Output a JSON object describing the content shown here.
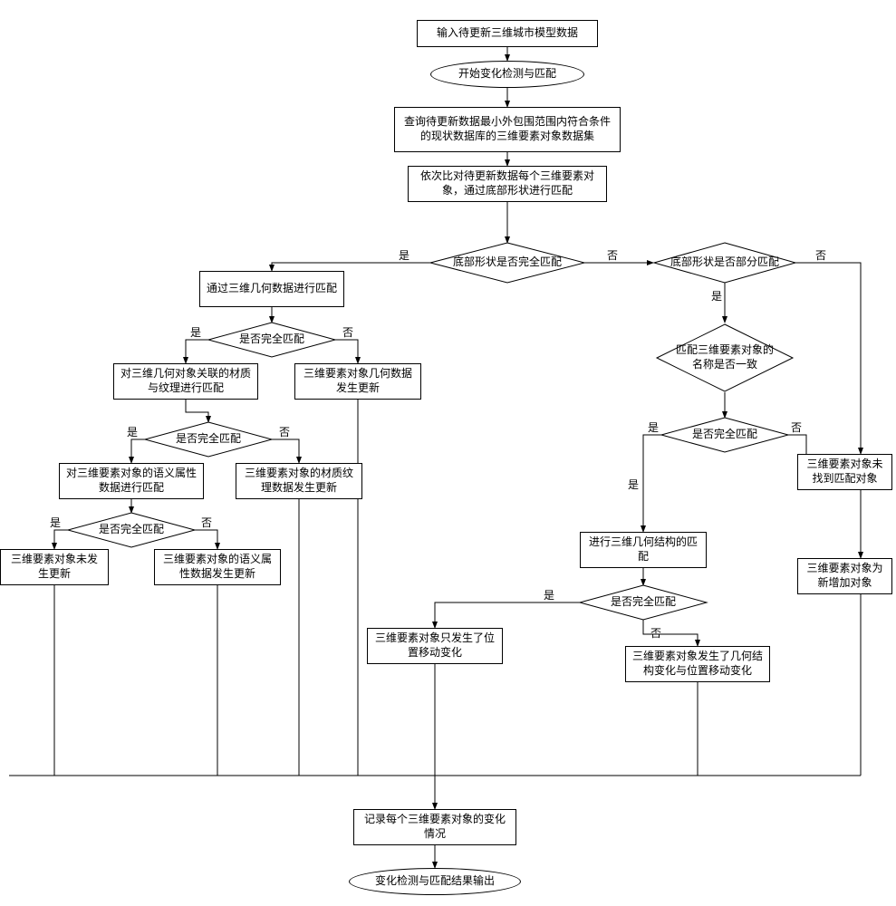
{
  "n1": "输入待更新三维城市模型数据",
  "n2": "开始变化检测与匹配",
  "n3": "查询待更新数据最小外包围范围内符合条件的现状数据库的三维要素对象数据集",
  "n4": "依次比对待更新数据每个三维要素对象，通过底部形状进行匹配",
  "d1": "底部形状是否完全匹配",
  "d2": "底部形状是否部分匹配",
  "n5": "通过三维几何数据进行匹配",
  "d3": "是否完全匹配",
  "n6": "三维要素对象几何数据发生更新",
  "n7": "对三维几何对象关联的材质与纹理进行匹配",
  "d4": "是否完全匹配",
  "n8": "三维要素对象的材质纹理数据发生更新",
  "n9": "对三维要素对象的语义属性数据进行匹配",
  "d5": "是否完全匹配",
  "n10": "三维要素对象未发生更新",
  "n11": "三维要素对象的语义属性数据发生更新",
  "n12": "三维要素对象只发生了位置移动变化",
  "d6": "匹配三维要素对象的名称是否一致",
  "d7": "是否完全匹配",
  "n13": "进行三维几何结构的匹配",
  "d8": "是否完全匹配",
  "n14": "三维要素对象发生了几何结构变化与位置移动变化",
  "n15": "三维要素对象未找到匹配对象",
  "n16": "三维要素对象为新增加对象",
  "n17": "记录每个三维要素对象的变化情况",
  "n18": "变化检测与匹配结果输出",
  "yes": "是",
  "no": "否"
}
